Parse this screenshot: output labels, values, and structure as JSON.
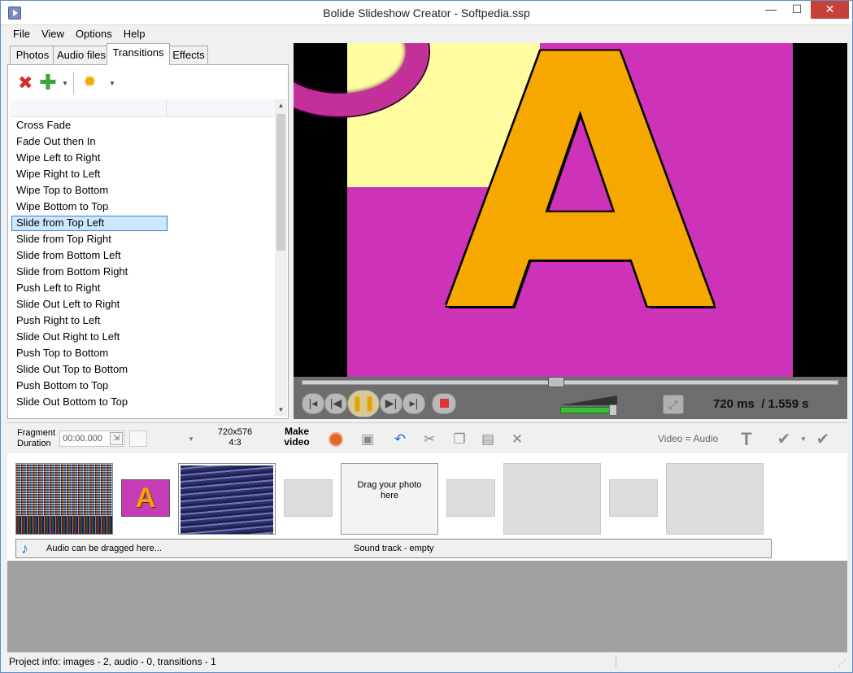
{
  "window": {
    "title": "Bolide Slideshow Creator - Softpedia.ssp",
    "min_glyph": "—",
    "max_glyph": "☐",
    "close_glyph": "✕"
  },
  "menu": [
    "File",
    "View",
    "Options",
    "Help"
  ],
  "tabs": [
    "Photos",
    "Audio files",
    "Transitions",
    "Effects"
  ],
  "transitions": [
    "Cross Fade",
    "Fade Out then In",
    "Wipe Left to Right",
    "Wipe Right to Left",
    "Wipe Top to Bottom",
    "Wipe Bottom to Top",
    "Slide from Top Left",
    "Slide from Top Right",
    "Slide from Bottom Left",
    "Slide from Bottom Right",
    "Push Left to Right",
    "Slide Out Left to Right",
    "Push Right to Left",
    "Slide Out Right to Left",
    "Push Top to Bottom",
    "Slide Out Top to Bottom",
    "Push Bottom to Top",
    "Slide Out Bottom to Top"
  ],
  "selected_transition": "Slide from Top Left",
  "player": {
    "time_ms": "720 ms",
    "duration": "/ 1.559 s",
    "preview_letter": "A"
  },
  "toolbar": {
    "fragment_label": "Fragment",
    "duration_label": "Duration",
    "duration_value": "00:00.000",
    "resolution": "720x576",
    "aspect": "4:3",
    "make_label": "Make",
    "video_label": "video",
    "video_audio": "Video = Audio"
  },
  "storyboard": {
    "transition_letter": "A",
    "drop_line1": "Drag your photo",
    "drop_line2": "here",
    "audio_hint": "Audio can be dragged here...",
    "sound_track": "Sound track - empty"
  },
  "status": {
    "project_info": "Project info: images - 2, audio - 0, transitions - 1"
  },
  "colors": {
    "slide_bg": "#cc33b8",
    "accent_selection": "#cce8ff",
    "volume": "#3bbf3b"
  },
  "icons": [
    "delete-icon",
    "add-icon",
    "effects-star-icon",
    "record-icon",
    "save-icon",
    "undo-icon",
    "cut-icon",
    "copy-icon",
    "paste-icon",
    "remove-icon",
    "text-icon",
    "apply-icon",
    "apply-all-icon",
    "music-note-icon",
    "fullscreen-icon"
  ]
}
